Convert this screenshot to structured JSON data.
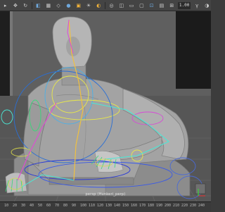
{
  "toolbar": {
    "field_value": "1.00",
    "icons": [
      "select-tool-icon",
      "move-tool-icon",
      "rotate-tool-icon",
      "scale-tool-icon",
      "camera-icon",
      "grid-icon",
      "wireframe-icon",
      "smooth-shade-icon",
      "texture-icon",
      "light-icon",
      "shadow-icon",
      "xray-icon",
      "isolate-icon",
      "film-gate-icon",
      "resolution-gate-icon",
      "safe-frame-icon",
      "gate-mask-icon",
      "field-chart-icon"
    ]
  },
  "viewport": {
    "camera_label": "persp (Hunkeri_perp)"
  },
  "timeline": {
    "ticks": [
      "10",
      "20",
      "30",
      "40",
      "50",
      "60",
      "70",
      "80",
      "90",
      "100",
      "110",
      "120",
      "130",
      "140",
      "150",
      "160",
      "170",
      "180",
      "190",
      "200",
      "210",
      "220",
      "230",
      "240"
    ]
  }
}
